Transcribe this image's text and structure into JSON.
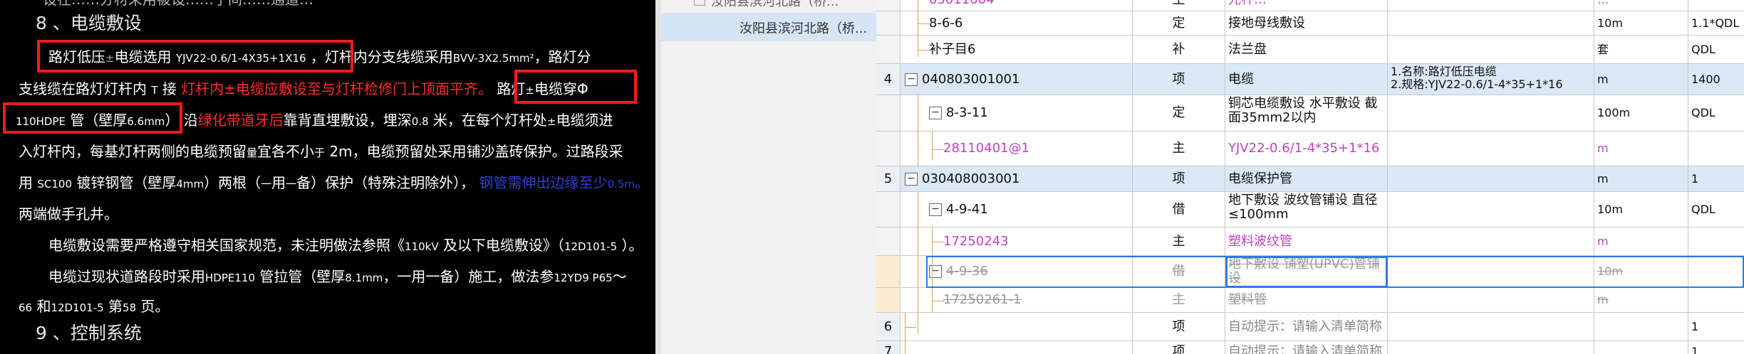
{
  "document": {
    "top_partial": "设在……分材采用被设……子间……通道…",
    "heading8": "8 、电缆敷设",
    "p1": {
      "seg1": "路灯低压",
      "seg2": "电缆选用",
      "seg3": "YJV22-0.6/1-4X35+1X16",
      "seg4": "，灯杆内分支线缆采用",
      "seg5": "BVV-3X2.5mm²",
      "seg6": "，路灯分"
    },
    "p2": {
      "seg1": "支线缆在路灯灯杆内",
      "seg2": "接",
      "seg3": "灯杆内",
      "seg4": "电缆应敷设至与灯杆检修门上顶面平齐。",
      "seg5": "路灯",
      "seg6": "电缆穿"
    },
    "p3": {
      "seg1": "110HDPE",
      "seg2": "管（壁厚",
      "seg3": "6.6mm",
      "seg4": "）",
      "seg5": "沿",
      "seg6": "绿化带道牙后",
      "seg7": "靠背直埋敷设，埋深",
      "seg8": "0.8",
      "seg9": "米，在每个灯杆处",
      "seg10": "电缆须进"
    },
    "p4": {
      "seg1": "入灯杆内，每基灯杆两侧的电缆预留",
      "seg2": "宜各不小",
      "seg3": "2m，电缆预留处采用铺沙盖砖保护。过路段采"
    },
    "p5": {
      "seg1": "用",
      "seg2": "SC100",
      "seg3": "镀锌钢管（壁厚",
      "seg4": "4mm",
      "seg5": "）两根（",
      "seg6": "用",
      "seg7": "备）保护（特殊注明除外），",
      "seg8": "钢管需伸出边缘至少",
      "seg9": "0.5m",
      "seg10": "。"
    },
    "p6": "两端做手孔井。",
    "p7": {
      "seg1": "电缆敷设需要严格遵守相关国家规范，未注明做法参照《",
      "seg2": "110kV",
      "seg3": "及以下电缆敷设》（",
      "seg4": "12D101-5",
      "seg5": "）。"
    },
    "p8": {
      "seg1": "电缆过现状道路段时采用",
      "seg2": "HDPE110",
      "seg3": "管拉管（壁厚",
      "seg4": "8.1mm",
      "seg5": "，一用一备）施工，做法参",
      "seg6": "12YD9 P65",
      "seg7": "～"
    },
    "p9": {
      "seg1": "66",
      "seg2": "和",
      "seg3": "12D101-5",
      "seg4": "第",
      "seg5": "58",
      "seg6": "页。"
    },
    "heading9": "9 、控制系统"
  },
  "tree": {
    "item1": "汝阳县滨河北路（桥...",
    "item2": "汝阳县滨河北路（桥..."
  },
  "grid": {
    "rows": [
      {
        "num": "",
        "code": "05011004",
        "type": "主",
        "name": "光杆…",
        "feature": "",
        "unit": "…",
        "qty": "",
        "style": "pink",
        "level": 2
      },
      {
        "num": "",
        "code": "8-6-6",
        "type": "定",
        "name": "接地母线敷设",
        "feature": "",
        "unit": "10m",
        "qty": "1.1*QDL",
        "style": "normal",
        "level": 2
      },
      {
        "num": "",
        "code": "补子目6",
        "type": "补",
        "name": "法兰盘",
        "feature": "",
        "unit": "套",
        "qty": "QDL",
        "style": "normal",
        "level": 2
      },
      {
        "num": "4",
        "code": "040803001001",
        "type": "项",
        "name": "电缆",
        "feature1": "1.名称:路灯低压电缆",
        "feature2": "2.规格:YJV22-0.6/1-4*35+1*16",
        "unit": "m",
        "qty": "1400",
        "style": "item",
        "level": 1
      },
      {
        "num": "",
        "code": "8-3-11",
        "type": "定",
        "name1": "铜芯电缆敷设 水平敷设 截",
        "name2": "面35mm2以内",
        "feature": "",
        "unit": "100m",
        "qty": "QDL",
        "style": "normal",
        "level": 2
      },
      {
        "num": "",
        "code": "28110401@1",
        "type": "主",
        "name": "YJV22-0.6/1-4*35+1*16",
        "feature": "",
        "unit": "m",
        "qty": "",
        "style": "pink",
        "level": 3
      },
      {
        "num": "5",
        "code": "030408003001",
        "type": "项",
        "name": "电缆保护管",
        "feature": "",
        "unit": "m",
        "qty": "1",
        "style": "item",
        "level": 1
      },
      {
        "num": "",
        "code": "4-9-41",
        "type": "借",
        "name1": "地下敷设 波纹管铺设 直径",
        "name2": "≤100mm",
        "feature": "",
        "unit": "10m",
        "qty": "QDL",
        "style": "normal",
        "level": 2
      },
      {
        "num": "",
        "code": "17250243",
        "type": "主",
        "name": "塑料波纹管",
        "feature": "",
        "unit": "m",
        "qty": "",
        "style": "pink",
        "level": 3
      },
      {
        "num": "",
        "code": "4-9-36",
        "type": "借",
        "name1": "地下敷设 铺塑(UPVC)管铺设",
        "name2": "直径≤100mm",
        "feature": "",
        "unit": "10m",
        "qty": "",
        "style": "strike",
        "level": 2
      },
      {
        "num": "",
        "code": "17250261-1",
        "type": "主",
        "name": "塑料管",
        "feature": "",
        "unit": "m",
        "qty": "",
        "style": "strike",
        "level": 3
      },
      {
        "num": "6",
        "code": "",
        "type": "项",
        "name": "自动提示：请输入清单简称",
        "feature": "",
        "unit": "",
        "qty": "1",
        "style": "hint",
        "level": 1
      },
      {
        "num": "7",
        "code": "",
        "type": "项",
        "name": "自动提示：请输入清单简称",
        "feature": "",
        "unit": "",
        "qty": "1",
        "style": "hint",
        "level": 1
      }
    ]
  }
}
